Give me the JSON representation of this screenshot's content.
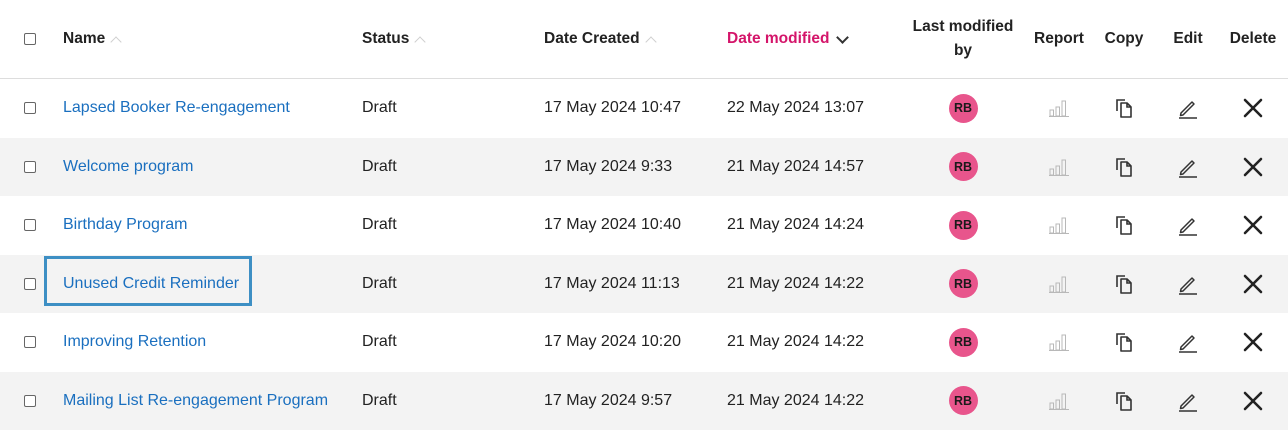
{
  "header": {
    "name": "Name",
    "status": "Status",
    "date_created": "Date Created",
    "date_modified": "Date modified",
    "last_modified_line1": "Last modified",
    "last_modified_line2": "by",
    "report": "Report",
    "copy": "Copy",
    "edit": "Edit",
    "delete": "Delete"
  },
  "colors": {
    "link": "#1a6fbf",
    "active_sort": "#d4156a",
    "avatar": "#e8558c",
    "highlight": "#3d8fc4",
    "row_alt": "#f3f3f3"
  },
  "icons": {
    "report": "bar-chart-icon",
    "copy": "copy-icon",
    "edit": "pencil-icon",
    "delete": "close-icon"
  },
  "rows": [
    {
      "name": "Lapsed Booker Re-engagement",
      "status": "Draft",
      "created": "17 May 2024 10:47",
      "modified": "22 May 2024 13:07",
      "by": "RB"
    },
    {
      "name": "Welcome program",
      "status": "Draft",
      "created": "17 May 2024 9:33",
      "modified": "21 May 2024 14:57",
      "by": "RB"
    },
    {
      "name": "Birthday Program",
      "status": "Draft",
      "created": "17 May 2024 10:40",
      "modified": "21 May 2024 14:24",
      "by": "RB"
    },
    {
      "name": "Unused Credit Reminder",
      "status": "Draft",
      "created": "17 May 2024 11:13",
      "modified": "21 May 2024 14:22",
      "by": "RB"
    },
    {
      "name": "Improving Retention",
      "status": "Draft",
      "created": "17 May 2024 10:20",
      "modified": "21 May 2024 14:22",
      "by": "RB"
    },
    {
      "name": "Mailing List Re-engagement Program",
      "status": "Draft",
      "created": "17 May 2024 9:57",
      "modified": "21 May 2024 14:22",
      "by": "RB"
    }
  ]
}
